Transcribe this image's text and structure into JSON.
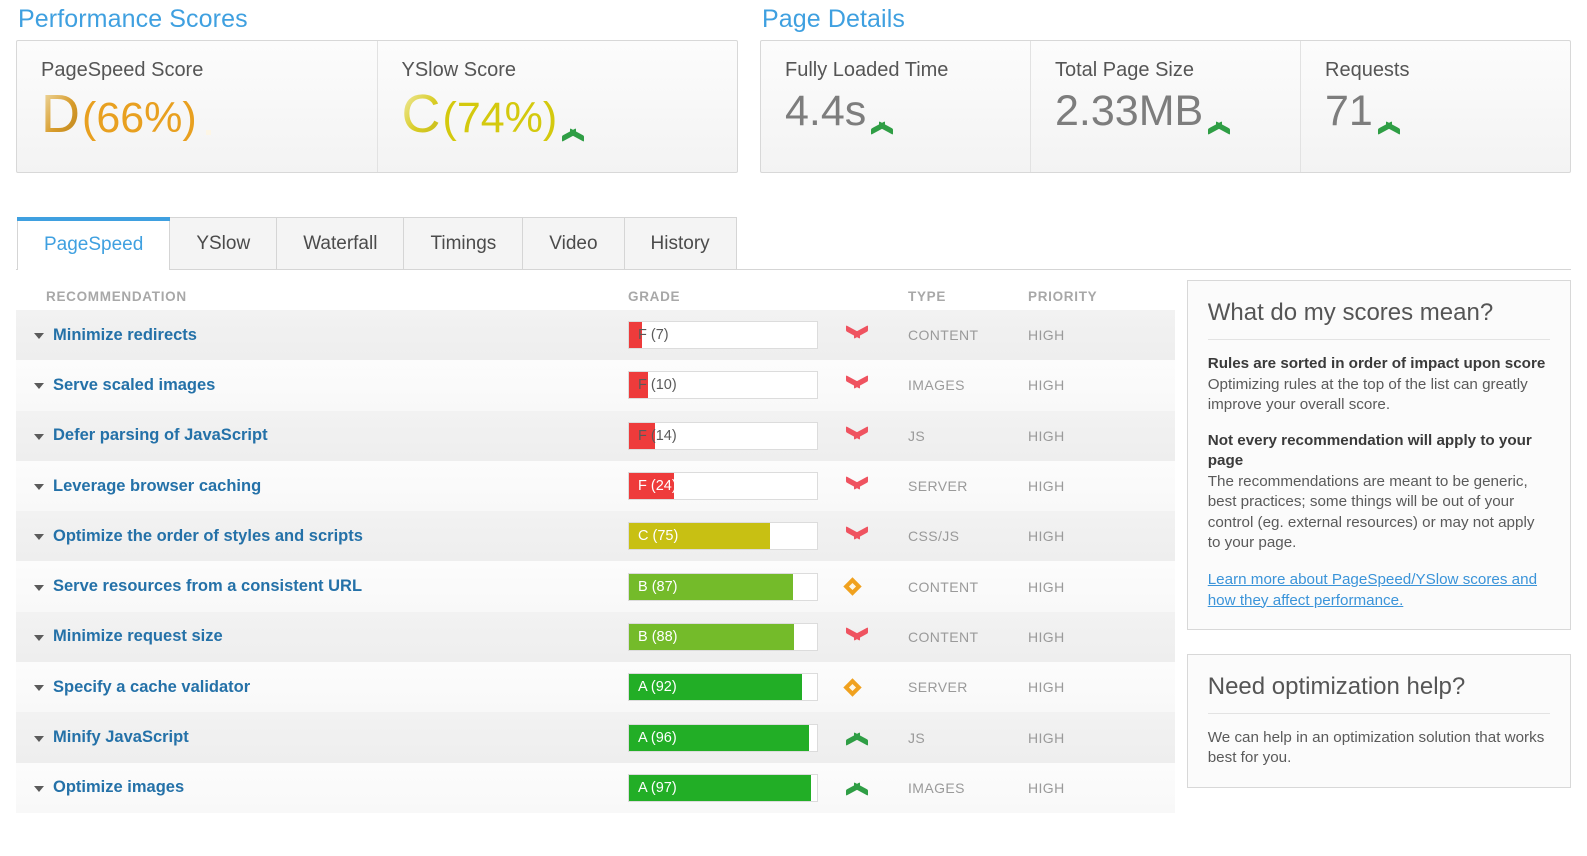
{
  "performance": {
    "title": "Performance Scores",
    "metrics": [
      {
        "label": "PageSpeed Score",
        "grade": "D",
        "pct": "(66%)",
        "trend": "diamond"
      },
      {
        "label": "YSlow Score",
        "grade": "C",
        "pct": "(74%)",
        "trend": "up"
      }
    ]
  },
  "page_details": {
    "title": "Page Details",
    "metrics": [
      {
        "label": "Fully Loaded Time",
        "value": "4.4s",
        "trend": "up"
      },
      {
        "label": "Total Page Size",
        "value": "2.33MB",
        "trend": "up"
      },
      {
        "label": "Requests",
        "value": "71",
        "trend": "up"
      }
    ]
  },
  "tabs": [
    {
      "label": "PageSpeed",
      "active": true
    },
    {
      "label": "YSlow",
      "active": false
    },
    {
      "label": "Waterfall",
      "active": false
    },
    {
      "label": "Timings",
      "active": false
    },
    {
      "label": "Video",
      "active": false
    },
    {
      "label": "History",
      "active": false
    }
  ],
  "table": {
    "headers": {
      "recommendation": "RECOMMENDATION",
      "grade": "GRADE",
      "type": "TYPE",
      "priority": "PRIORITY"
    },
    "rows": [
      {
        "recommendation": "Minimize redirects",
        "grade_label": "F (7)",
        "score": 7,
        "color": "#ee3b3b",
        "trend": "down",
        "type": "CONTENT",
        "priority": "HIGH"
      },
      {
        "recommendation": "Serve scaled images",
        "grade_label": "F (10)",
        "score": 10,
        "color": "#ee3b3b",
        "trend": "down",
        "type": "IMAGES",
        "priority": "HIGH"
      },
      {
        "recommendation": "Defer parsing of JavaScript",
        "grade_label": "F (14)",
        "score": 14,
        "color": "#ee3b3b",
        "trend": "down",
        "type": "JS",
        "priority": "HIGH"
      },
      {
        "recommendation": "Leverage browser caching",
        "grade_label": "F (24)",
        "score": 24,
        "color": "#ee3b3b",
        "trend": "down",
        "type": "SERVER",
        "priority": "HIGH"
      },
      {
        "recommendation": "Optimize the order of styles and scripts",
        "grade_label": "C (75)",
        "score": 75,
        "color": "#c8c013",
        "trend": "down",
        "type": "CSS/JS",
        "priority": "HIGH"
      },
      {
        "recommendation": "Serve resources from a consistent URL",
        "grade_label": "B (87)",
        "score": 87,
        "color": "#74bb2a",
        "trend": "diamond",
        "type": "CONTENT",
        "priority": "HIGH"
      },
      {
        "recommendation": "Minimize request size",
        "grade_label": "B (88)",
        "score": 88,
        "color": "#74bb2a",
        "trend": "down",
        "type": "CONTENT",
        "priority": "HIGH"
      },
      {
        "recommendation": "Specify a cache validator",
        "grade_label": "A (92)",
        "score": 92,
        "color": "#22ae26",
        "trend": "diamond",
        "type": "SERVER",
        "priority": "HIGH"
      },
      {
        "recommendation": "Minify JavaScript",
        "grade_label": "A (96)",
        "score": 96,
        "color": "#22ae26",
        "trend": "up",
        "type": "JS",
        "priority": "HIGH"
      },
      {
        "recommendation": "Optimize images",
        "grade_label": "A (97)",
        "score": 97,
        "color": "#22ae26",
        "trend": "up",
        "type": "IMAGES",
        "priority": "HIGH"
      }
    ]
  },
  "sidebar": {
    "scores_card": {
      "title": "What do my scores mean?",
      "b1_head": "Rules are sorted in order of impact upon score",
      "b1_body": "Optimizing rules at the top of the list can greatly improve your overall score.",
      "b2_head": "Not every recommendation will apply to your page",
      "b2_body": "The recommendations are meant to be generic, best practices; some things will be out of your control (eg. external resources) or may not apply to your page.",
      "link": "Learn more about PageSpeed/YSlow scores and how they affect performance."
    },
    "help_card": {
      "title": "Need optimization help?",
      "body": "We can help in an optimization solution that works best for you."
    }
  },
  "colors": {
    "accent_blue": "#3fa0e0",
    "link_blue": "#2471a8",
    "grade_f": "#ee3b3b",
    "grade_c": "#c8c013",
    "grade_b": "#74bb2a",
    "grade_a": "#22ae26",
    "trend_up": "#2f9e45",
    "trend_down": "#ef5360",
    "trend_neutral": "#f0a11e"
  }
}
